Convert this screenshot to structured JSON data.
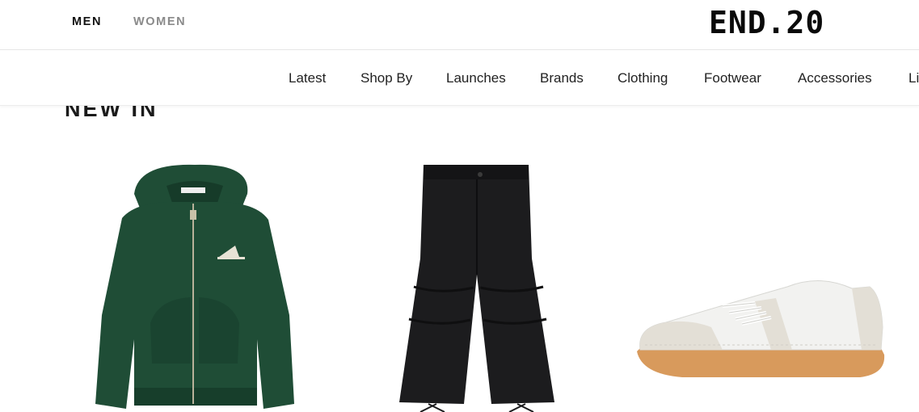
{
  "header": {
    "gender_tabs": [
      {
        "label": "MEN",
        "active": true
      },
      {
        "label": "WOMEN",
        "active": false
      }
    ],
    "logo_text": "END.20"
  },
  "nav": {
    "items": [
      "Latest",
      "Shop By",
      "Launches",
      "Brands",
      "Clothing",
      "Footwear",
      "Accessories",
      "Li"
    ]
  },
  "section": {
    "title": "NEW IN"
  },
  "products": [
    {
      "image": "green-zip-hoodie",
      "color": "#1f4d36"
    },
    {
      "image": "black-cargo-trousers",
      "color": "#1c1c1e"
    },
    {
      "image": "white-gum-sole-trainer",
      "color": "#f2f2f0",
      "accent": "#d89a5c"
    }
  ]
}
